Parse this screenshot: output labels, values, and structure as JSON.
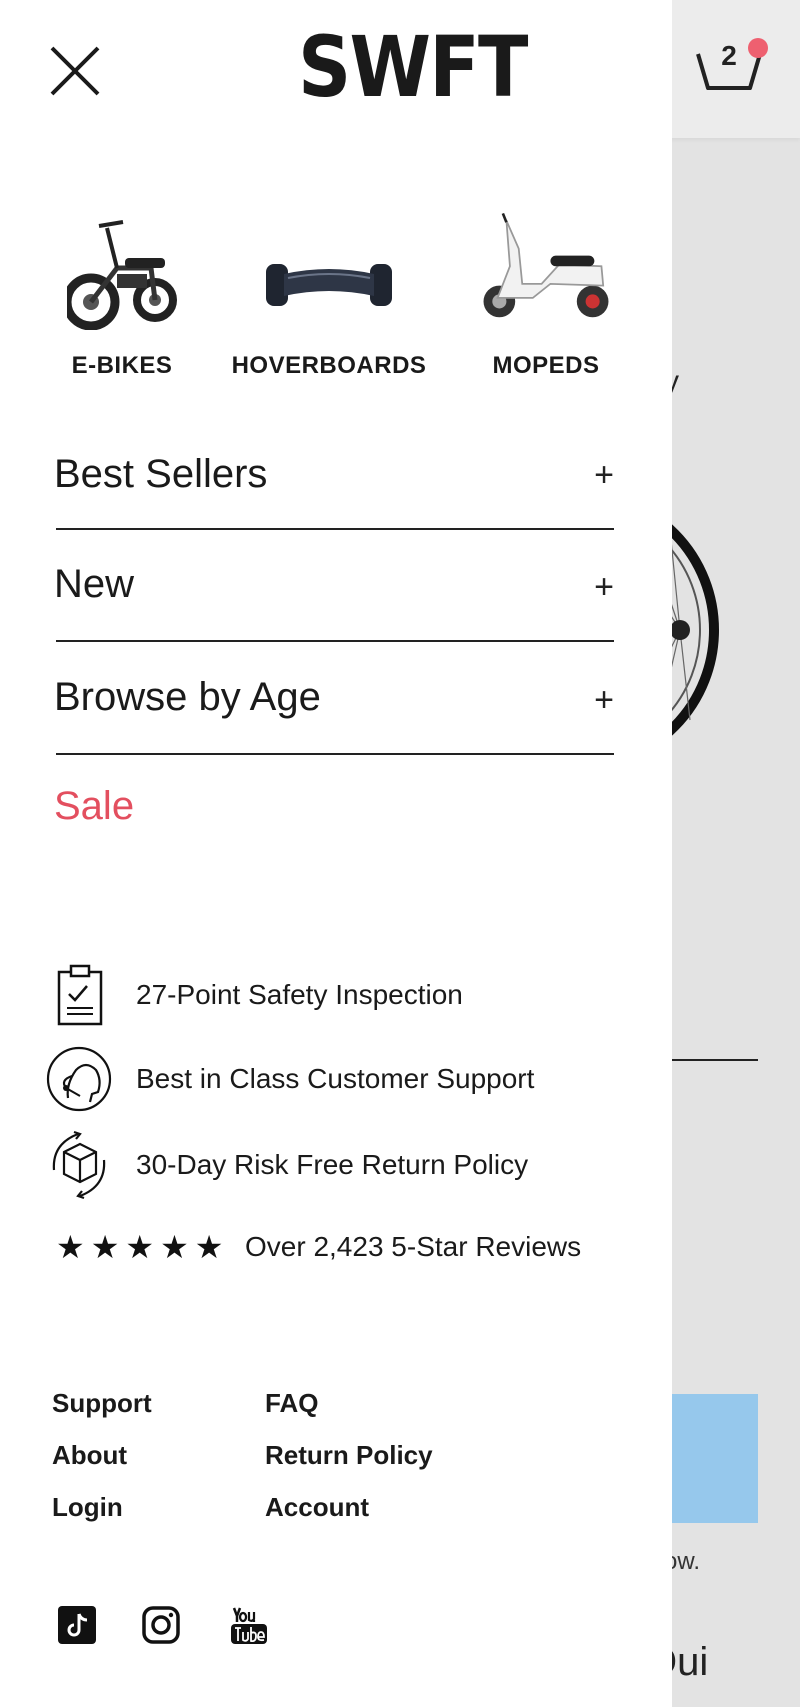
{
  "brand": {
    "logo": "SWFT"
  },
  "cart": {
    "count": "2"
  },
  "categories": [
    {
      "label": "E-BIKES"
    },
    {
      "label": "HOVERBOARDS"
    },
    {
      "label": "MOPEDS"
    }
  ],
  "menu": {
    "items": [
      {
        "label": "Best Sellers",
        "icon": "+"
      },
      {
        "label": "New",
        "icon": "+"
      },
      {
        "label": "Browse by Age",
        "icon": "+"
      }
    ],
    "sale_label": "Sale"
  },
  "features": [
    {
      "icon": "clipboard-check-icon",
      "text": "27-Point Safety Inspection"
    },
    {
      "icon": "support-headset-icon",
      "text": "Best in Class Customer Support"
    },
    {
      "icon": "return-box-icon",
      "text": "30-Day Risk Free Return Policy"
    }
  ],
  "reviews": {
    "stars": "★★★★★",
    "text": "Over 2,423 5-Star Reviews"
  },
  "footer": {
    "left": [
      "Support",
      "About",
      "Login"
    ],
    "right": [
      "FAQ",
      "Return Policy",
      "Account"
    ]
  },
  "social": [
    "tiktok-icon",
    "instagram-icon",
    "youtube-icon"
  ],
  "background_text": {
    "fragment1": "ow.",
    "fragment2": "Qui",
    "fragment0": "y"
  },
  "colors": {
    "sale": "#e34f5f",
    "cart_dot": "#ee6070",
    "bg_blue": "#96c8ec"
  }
}
